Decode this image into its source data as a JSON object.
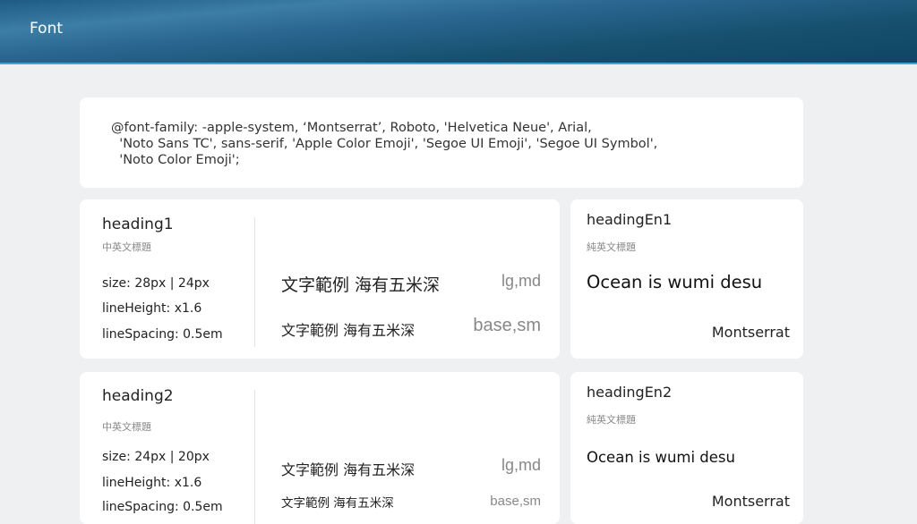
{
  "header": {
    "title": "Font"
  },
  "font_family": {
    "line1": "@font-family: -apple-system, ‘Montserrat’, Roboto, 'Helvetica Neue', Arial,",
    "line2": "  'Noto Sans TC', sans-serif, 'Apple Color Emoji', 'Segoe UI Emoji', 'Segoe UI Symbol',",
    "line3": "  'Noto Color Emoji';"
  },
  "heading_cards": [
    {
      "title": "heading1",
      "subtitle": "中英文標題",
      "size": "size: 28px |  24px",
      "line_height": "lineHeight:  x1.6",
      "line_spacing": "lineSpacing:  0.5em",
      "samples": [
        {
          "text": "文字範例 海有五米深",
          "label": "lg,md"
        },
        {
          "text": "文字範例 海有五米深",
          "label": "base,sm"
        }
      ]
    },
    {
      "title": "heading2",
      "subtitle": "中英文標題",
      "size": "size: 24px |  20px",
      "line_height": "lineHeight:  x1.6",
      "line_spacing": "lineSpacing:  0.5em",
      "samples": [
        {
          "text": "文字範例 海有五米深",
          "label": "lg,md"
        },
        {
          "text": "文字範例 海有五米深",
          "label": "base,sm"
        }
      ]
    }
  ],
  "english_cards": [
    {
      "title": "headingEn1",
      "subtitle": "純英文標題",
      "sample": "Ocean is wumi desu",
      "font_name": "Montserrat"
    },
    {
      "title": "headingEn2",
      "subtitle": "純英文標題",
      "sample": "Ocean is wumi desu",
      "font_name": "Montserrat"
    }
  ]
}
